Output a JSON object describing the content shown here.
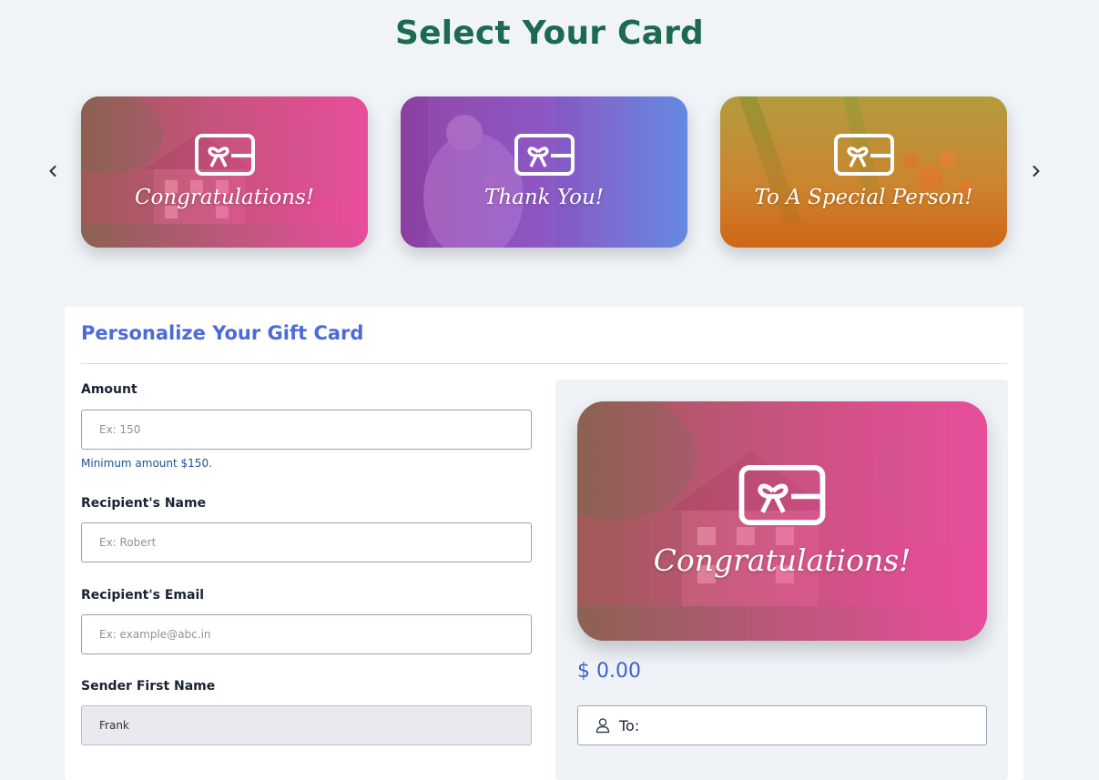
{
  "header": {
    "title": "Select Your Card"
  },
  "carousel": {
    "prev_icon": "chevron-left-icon",
    "next_icon": "chevron-right-icon",
    "cards": [
      {
        "label": "Congratulations!",
        "icon": "gift-card-icon"
      },
      {
        "label": "Thank You!",
        "icon": "gift-card-icon"
      },
      {
        "label": "To A Special Person!",
        "icon": "gift-card-icon"
      }
    ]
  },
  "form": {
    "title": "Personalize Your Gift Card",
    "amount": {
      "label": "Amount",
      "placeholder": "Ex: 150",
      "value": "",
      "hint": "Minimum amount $150."
    },
    "recipient_name": {
      "label": "Recipient's Name",
      "placeholder": "Ex: Robert",
      "value": ""
    },
    "recipient_email": {
      "label": "Recipient's Email",
      "placeholder": "Ex: example@abc.in",
      "value": ""
    },
    "sender_first_name": {
      "label": "Sender First Name",
      "value": "Frank"
    }
  },
  "preview": {
    "card_label": "Congratulations!",
    "amount": "$ 0.00",
    "to_label": "To:",
    "to_icon": "user-icon"
  },
  "colors": {
    "title_green": "#1c6b4f",
    "accent_blue": "#4c6bd6",
    "amount_blue": "#3d61c8",
    "card_pink": "#ec4899",
    "card_purple": "#8b5cf6",
    "card_orange": "#d97706"
  }
}
